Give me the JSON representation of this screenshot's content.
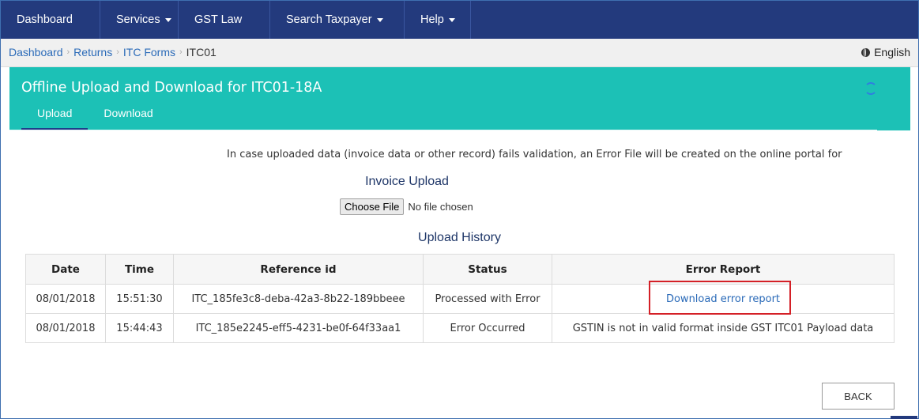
{
  "nav": {
    "items": [
      {
        "label": "Dashboard",
        "dropdown": false
      },
      {
        "label": "Services",
        "dropdown": true
      },
      {
        "label": "GST Law",
        "dropdown": false
      },
      {
        "label": "Search Taxpayer",
        "dropdown": true
      },
      {
        "label": "Help",
        "dropdown": true
      }
    ]
  },
  "breadcrumb": {
    "items": [
      "Dashboard",
      "Returns",
      "ITC Forms"
    ],
    "current": "ITC01"
  },
  "language": "English",
  "panel": {
    "title": "Offline Upload and Download for ITC01-18A",
    "tabs": [
      "Upload",
      "Download"
    ],
    "active_tab": "Upload"
  },
  "info_text": "In case uploaded data (invoice data or other record) fails validation, an Error File will be created on the online portal for",
  "invoice_upload": {
    "title": "Invoice Upload",
    "choose_label": "Choose File",
    "file_status": "No file chosen"
  },
  "history": {
    "title": "Upload History",
    "columns": [
      "Date",
      "Time",
      "Reference id",
      "Status",
      "Error Report"
    ],
    "rows": [
      {
        "date": "08/01/2018",
        "time": "15:51:30",
        "ref": "ITC_185fe3c8-deba-42a3-8b22-189bbeee",
        "status": "Processed with Error",
        "report": "Download error report",
        "report_is_link": true
      },
      {
        "date": "08/01/2018",
        "time": "15:44:43",
        "ref": "ITC_185e2245-eff5-4231-be0f-64f33aa1",
        "status": "Error Occurred",
        "report": "GSTIN is not in valid format inside GST ITC01 Payload data",
        "report_is_link": false
      }
    ]
  },
  "back_label": "BACK",
  "colors": {
    "nav_bg": "#233a7d",
    "panel_bg": "#1cc1b6",
    "link": "#2a6ab8",
    "highlight": "#d42027"
  }
}
